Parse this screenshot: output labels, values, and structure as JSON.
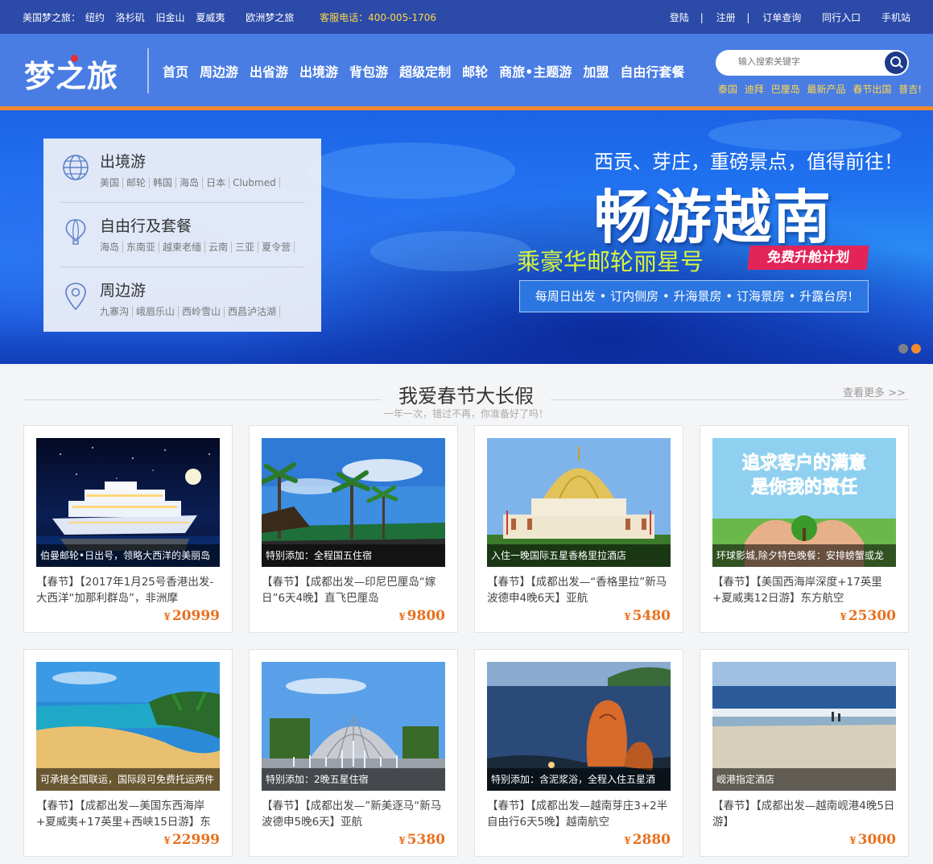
{
  "topbar": {
    "usa_label": "美国梦之旅：",
    "usa_cities": [
      "纽约",
      "洛杉矶",
      "旧金山",
      "夏威夷"
    ],
    "europe": "欧洲梦之旅",
    "phone": "客服电话：400-005-1706",
    "links": [
      "登陆",
      "注册",
      "订单查询",
      "同行入口",
      "手机站"
    ],
    "separator": "|"
  },
  "header": {
    "logo": "梦之旅",
    "nav": [
      "首页",
      "周边游",
      "出省游",
      "出境游",
      "背包游",
      "超级定制",
      "邮轮",
      "商旅•主题游",
      "加盟",
      "自由行套餐"
    ],
    "search_placeholder": "输入搜索关键字",
    "hotkeys": [
      "泰国",
      "迪拜",
      "巴厘岛",
      "最新产品",
      "春节出国",
      "普吉!"
    ]
  },
  "banner": {
    "menu": [
      {
        "title": "出境游",
        "icon": "globe-icon",
        "subs": [
          "美国",
          "邮轮",
          "韩国",
          "海岛",
          "日本",
          "Clubmed"
        ]
      },
      {
        "title": "自由行及套餐",
        "icon": "hot-air-balloon-icon",
        "subs": [
          "海岛",
          "东南亚",
          "越柬老缅",
          "云南",
          "三亚",
          "夏令营"
        ]
      },
      {
        "title": "周边游",
        "icon": "location-pin-icon",
        "subs": [
          "九寨沟",
          "峨眉乐山",
          "西岭雪山",
          "西昌泸沽湖"
        ]
      }
    ],
    "slogan": "西贡、芽庄，重磅景点，值得前往！",
    "headline": "畅游越南",
    "cruise": "乘豪华邮轮丽星号",
    "upgrade": "免费升舱计划",
    "weekly": "每周日出发 • 订内侧房 • 升海景房 • 订海景房 • 升露台房!",
    "colors": {
      "dot_inactive": "#7a7f88",
      "dot_active": "#f28a2e"
    }
  },
  "section": {
    "title": "我爱春节大长假",
    "subtitle": "一年一次，错过不再，你准备好了吗！",
    "more": "查看更多 >>"
  },
  "cards": [
    {
      "caption": "伯曼邮轮•日出号，领略大西洋的美丽岛",
      "desc": "【春节】【2017年1月25号香港出发-大西洋“加那利群岛”，非洲摩",
      "price": "20999",
      "scene": "cruise-night"
    },
    {
      "caption": "特别添加：全程国五住宿",
      "desc": "【春节】【成都出发—印尼巴厘岛“嫁日”6天4晚】直飞巴厘岛",
      "price": "9800",
      "scene": "tropical-beach"
    },
    {
      "caption": "入住一晚国际五星香格里拉酒店",
      "desc": "【春节】【成都出发—“香格里拉”新马波德申4晚6天】亚航",
      "price": "5480",
      "scene": "mosque"
    },
    {
      "caption": "环球影城,除夕特色晚餐：安排螃蟹或龙",
      "desc": "【春节】【美国西海岸深度+17英里+夏威夷12日游】东方航空",
      "price": "25300",
      "scene": "heart-hands"
    },
    {
      "caption": "可承接全国联运，国际段可免费托运两件",
      "desc": "【春节】【成都出发—美国东西海岸+夏威夷+17英里+西峡15日游】东",
      "price": "22999",
      "scene": "golden-beach"
    },
    {
      "caption": "特别添加：2晚五星住宿",
      "desc": "【春节】【成都出发—”新美逐马“新马波德申5晚6天】亚航",
      "price": "5380",
      "scene": "dome-fountain"
    },
    {
      "caption": "特别添加：含泥浆浴，全程入住五星酒",
      "desc": "【春节】【成都出发—越南芽庄3+2半自由行6天5晚】越南航空",
      "price": "2880",
      "scene": "coast-rocks"
    },
    {
      "caption": "岘港指定酒店",
      "desc": "【春节】【成都出发—越南岘港4晚5日游】",
      "price": "3000",
      "scene": "sandy-shore"
    }
  ],
  "currency": "¥"
}
